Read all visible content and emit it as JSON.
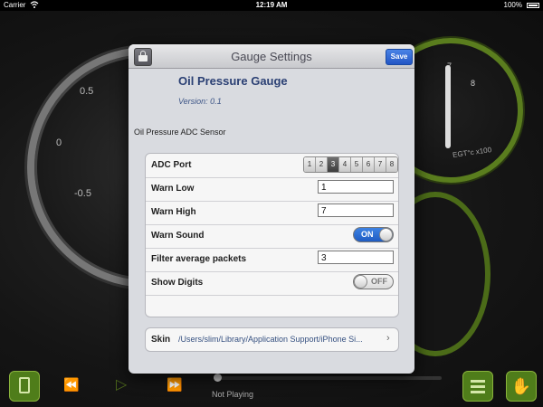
{
  "status_bar": {
    "carrier": "Carrier",
    "time": "12:19 AM",
    "battery": "100%",
    "wifi_icon": "wifi-icon",
    "battery_icon": "battery-icon"
  },
  "background": {
    "gauge_left_ticks": [
      "0.5",
      "0",
      "-0.5"
    ],
    "gauge_right_ticks": [
      "7",
      "8"
    ],
    "gauge_right_label": "EGT°c x100",
    "accent_green": "#4f7d1a"
  },
  "player": {
    "status": "Not Playing",
    "icons": [
      "ipod-icon",
      "rewind-icon",
      "play-icon",
      "fast-forward-icon",
      "list-icon",
      "hand-icon"
    ]
  },
  "modal": {
    "title": "Gauge Settings",
    "save_label": "Save",
    "lock_icon": "lock-icon",
    "gauge_name": "Oil Pressure Gauge",
    "version": "Version: 0.1",
    "sensor": "Oil Pressure ADC Sensor",
    "adc_port": {
      "label": "ADC Port",
      "options": [
        "1",
        "2",
        "3",
        "4",
        "5",
        "6",
        "7",
        "8"
      ],
      "selected": "3"
    },
    "warn_low": {
      "label": "Warn Low",
      "value": "1"
    },
    "warn_high": {
      "label": "Warn High",
      "value": "7"
    },
    "warn_sound": {
      "label": "Warn Sound",
      "state": "ON"
    },
    "filter": {
      "label": "Filter average packets",
      "value": "3"
    },
    "show_digits": {
      "label": "Show Digits",
      "state": "OFF"
    },
    "skin": {
      "label": "Skin",
      "path": "/Users/slim/Library/Application Support/iPhone Si..."
    }
  }
}
